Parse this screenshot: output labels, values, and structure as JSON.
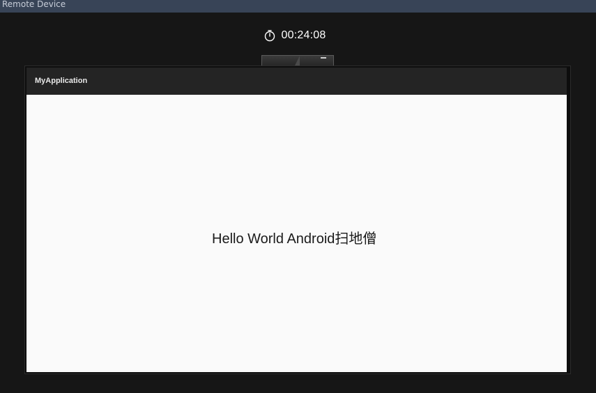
{
  "window": {
    "title": "Remote Device"
  },
  "session": {
    "elapsed_time": "00:24:08",
    "timer_icon": "stopwatch-icon"
  },
  "app": {
    "title": "MyApplication",
    "content_text": "Hello World Android扫地僧"
  },
  "colors": {
    "titlebar": "#384457",
    "background": "#161616",
    "appbar": "#242424",
    "content": "#fafafa"
  }
}
